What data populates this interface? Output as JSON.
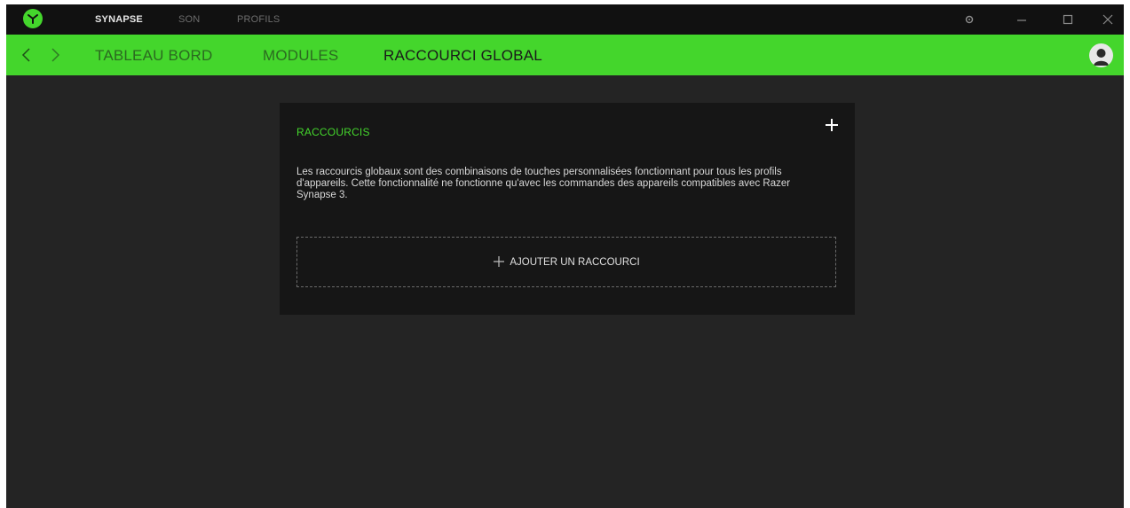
{
  "titlebar": {
    "tabs": [
      {
        "label": "SYNAPSE",
        "active": true
      },
      {
        "label": "SON",
        "active": false
      },
      {
        "label": "PROFILS",
        "active": false
      }
    ],
    "controls": [
      "settings-icon",
      "minimize-icon",
      "maximize-icon",
      "close-icon"
    ]
  },
  "navbar": {
    "tabs": [
      {
        "label": "TABLEAU BORD",
        "active": false
      },
      {
        "label": "MODULES",
        "active": false
      },
      {
        "label": "RACCOURCI GLOBAL",
        "active": true
      }
    ]
  },
  "panel": {
    "title": "RACCOURCIS",
    "description": "Les raccourcis globaux sont des combinaisons de touches personnalisées fonctionnant pour tous les profils d'appareils. Cette fonctionnalité ne fonctionne qu'avec les commandes des appareils compatibles avec Razer Synapse 3.",
    "add_button_label": "AJOUTER UN RACCOURCI"
  },
  "colors": {
    "accent": "#44d62c",
    "titlebar_bg": "#111111",
    "window_bg": "#242424",
    "panel_bg": "#161616"
  }
}
